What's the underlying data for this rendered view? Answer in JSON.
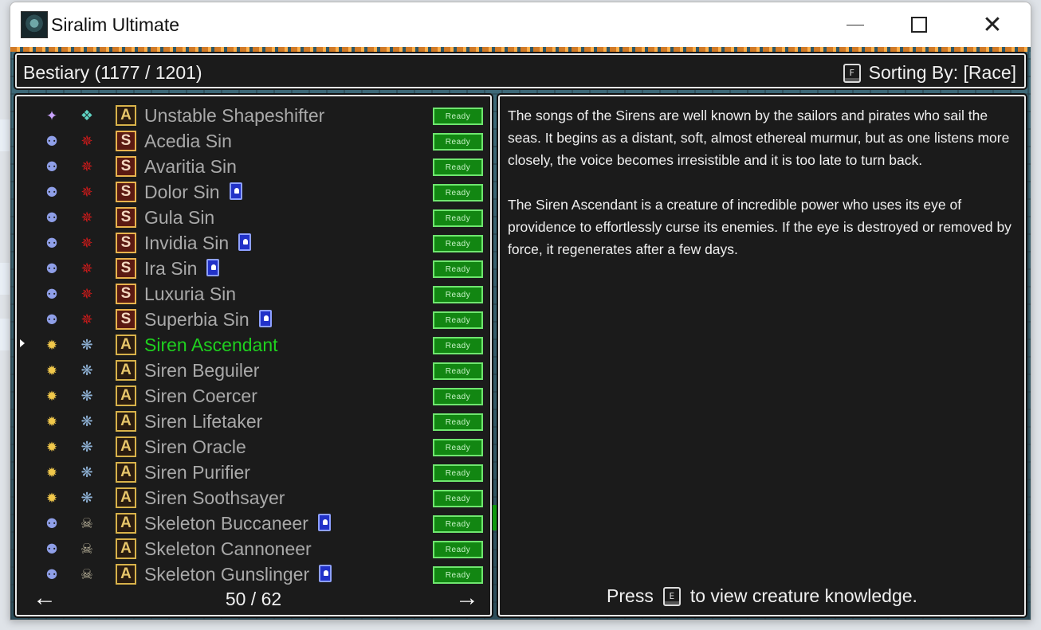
{
  "window": {
    "title": "Siralim Ultimate",
    "controls": {
      "minimize": "minimize-icon",
      "maximize": "maximize-icon",
      "close": "close-icon"
    }
  },
  "header": {
    "title": "Bestiary (1177 / 1201)",
    "sort_key": "F",
    "sort_label": "Sorting By: [Race]"
  },
  "list": {
    "rows": [
      {
        "class_icon": "purple-sparkle-icon",
        "race_icon": "shapeshifter-icon",
        "rarity": "A",
        "name": "Unstable Shapeshifter",
        "card": false,
        "status": "Ready",
        "selected": false
      },
      {
        "class_icon": "skull-blue-icon",
        "race_icon": "sin-pentagram-icon",
        "rarity": "S",
        "name": "Acedia Sin",
        "card": false,
        "status": "Ready",
        "selected": false
      },
      {
        "class_icon": "skull-blue-icon",
        "race_icon": "sin-pentagram-icon",
        "rarity": "S",
        "name": "Avaritia Sin",
        "card": false,
        "status": "Ready",
        "selected": false
      },
      {
        "class_icon": "skull-blue-icon",
        "race_icon": "sin-pentagram-icon",
        "rarity": "S",
        "name": "Dolor Sin",
        "card": true,
        "status": "Ready",
        "selected": false
      },
      {
        "class_icon": "skull-blue-icon",
        "race_icon": "sin-pentagram-icon",
        "rarity": "S",
        "name": "Gula Sin",
        "card": false,
        "status": "Ready",
        "selected": false
      },
      {
        "class_icon": "skull-blue-icon",
        "race_icon": "sin-pentagram-icon",
        "rarity": "S",
        "name": "Invidia Sin",
        "card": true,
        "status": "Ready",
        "selected": false
      },
      {
        "class_icon": "skull-blue-icon",
        "race_icon": "sin-pentagram-icon",
        "rarity": "S",
        "name": "Ira Sin",
        "card": true,
        "status": "Ready",
        "selected": false
      },
      {
        "class_icon": "skull-blue-icon",
        "race_icon": "sin-pentagram-icon",
        "rarity": "S",
        "name": "Luxuria Sin",
        "card": false,
        "status": "Ready",
        "selected": false
      },
      {
        "class_icon": "skull-blue-icon",
        "race_icon": "sin-pentagram-icon",
        "rarity": "S",
        "name": "Superbia Sin",
        "card": true,
        "status": "Ready",
        "selected": false
      },
      {
        "class_icon": "sun-icon",
        "race_icon": "siren-icon",
        "rarity": "A",
        "name": "Siren Ascendant",
        "card": false,
        "status": "Ready",
        "selected": true
      },
      {
        "class_icon": "sun-icon",
        "race_icon": "siren-icon",
        "rarity": "A",
        "name": "Siren Beguiler",
        "card": false,
        "status": "Ready",
        "selected": false
      },
      {
        "class_icon": "sun-icon",
        "race_icon": "siren-icon",
        "rarity": "A",
        "name": "Siren Coercer",
        "card": false,
        "status": "Ready",
        "selected": false
      },
      {
        "class_icon": "sun-icon",
        "race_icon": "siren-icon",
        "rarity": "A",
        "name": "Siren Lifetaker",
        "card": false,
        "status": "Ready",
        "selected": false
      },
      {
        "class_icon": "sun-icon",
        "race_icon": "siren-icon",
        "rarity": "A",
        "name": "Siren Oracle",
        "card": false,
        "status": "Ready",
        "selected": false
      },
      {
        "class_icon": "sun-icon",
        "race_icon": "siren-icon",
        "rarity": "A",
        "name": "Siren Purifier",
        "card": false,
        "status": "Ready",
        "selected": false
      },
      {
        "class_icon": "sun-icon",
        "race_icon": "siren-icon",
        "rarity": "A",
        "name": "Siren Soothsayer",
        "card": false,
        "status": "Ready",
        "selected": false
      },
      {
        "class_icon": "skull-blue-icon",
        "race_icon": "skeleton-icon",
        "rarity": "A",
        "name": "Skeleton Buccaneer",
        "card": true,
        "status": "Ready",
        "selected": false
      },
      {
        "class_icon": "skull-blue-icon",
        "race_icon": "skeleton-icon",
        "rarity": "A",
        "name": "Skeleton Cannoneer",
        "card": false,
        "status": "Ready",
        "selected": false
      },
      {
        "class_icon": "skull-blue-icon",
        "race_icon": "skeleton-icon",
        "rarity": "A",
        "name": "Skeleton Gunslinger",
        "card": true,
        "status": "Ready",
        "selected": false
      }
    ],
    "page": "50 / 62"
  },
  "description": {
    "paragraphs": [
      "The songs of the Sirens are well known by the sailors and pirates who sail the seas. It begins as a distant, soft, almost ethereal murmur, but as one listens more closely, the voice becomes irresistible and it is too late to turn back.",
      "The Siren Ascendant is a creature of incredible power who uses its eye of providence to effortlessly curse its enemies. If the eye is destroyed or removed by force, it regenerates after a few days."
    ],
    "footer_press": "Press",
    "footer_key": "E",
    "footer_action": "to view creature knowledge."
  },
  "colors": {
    "selected_name": "#1fd01f",
    "name": "#a9a9a9",
    "ready_bg": "#128612",
    "panel_bg": "#1b1b1b"
  }
}
